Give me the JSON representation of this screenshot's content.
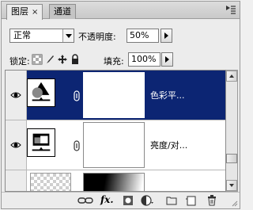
{
  "tabs": [
    {
      "label": "图层",
      "close": "×"
    },
    {
      "label": "通道"
    }
  ],
  "blend": {
    "mode": "正常",
    "opacity_label": "不透明度:",
    "opacity_value": "50%"
  },
  "lock": {
    "label": "锁定:",
    "fill_label": "填充:",
    "fill_value": "100%"
  },
  "layers": [
    {
      "name": "色彩平...",
      "selected": true,
      "icon": "color-balance-icon"
    },
    {
      "name": "亮度/对...",
      "selected": false,
      "icon": "brightness-contrast-icon"
    },
    {
      "name": "",
      "selected": false,
      "icon": "gradient-thumbnail"
    }
  ],
  "colors": {
    "selection": "#0c2573",
    "panel": "#ececec"
  }
}
